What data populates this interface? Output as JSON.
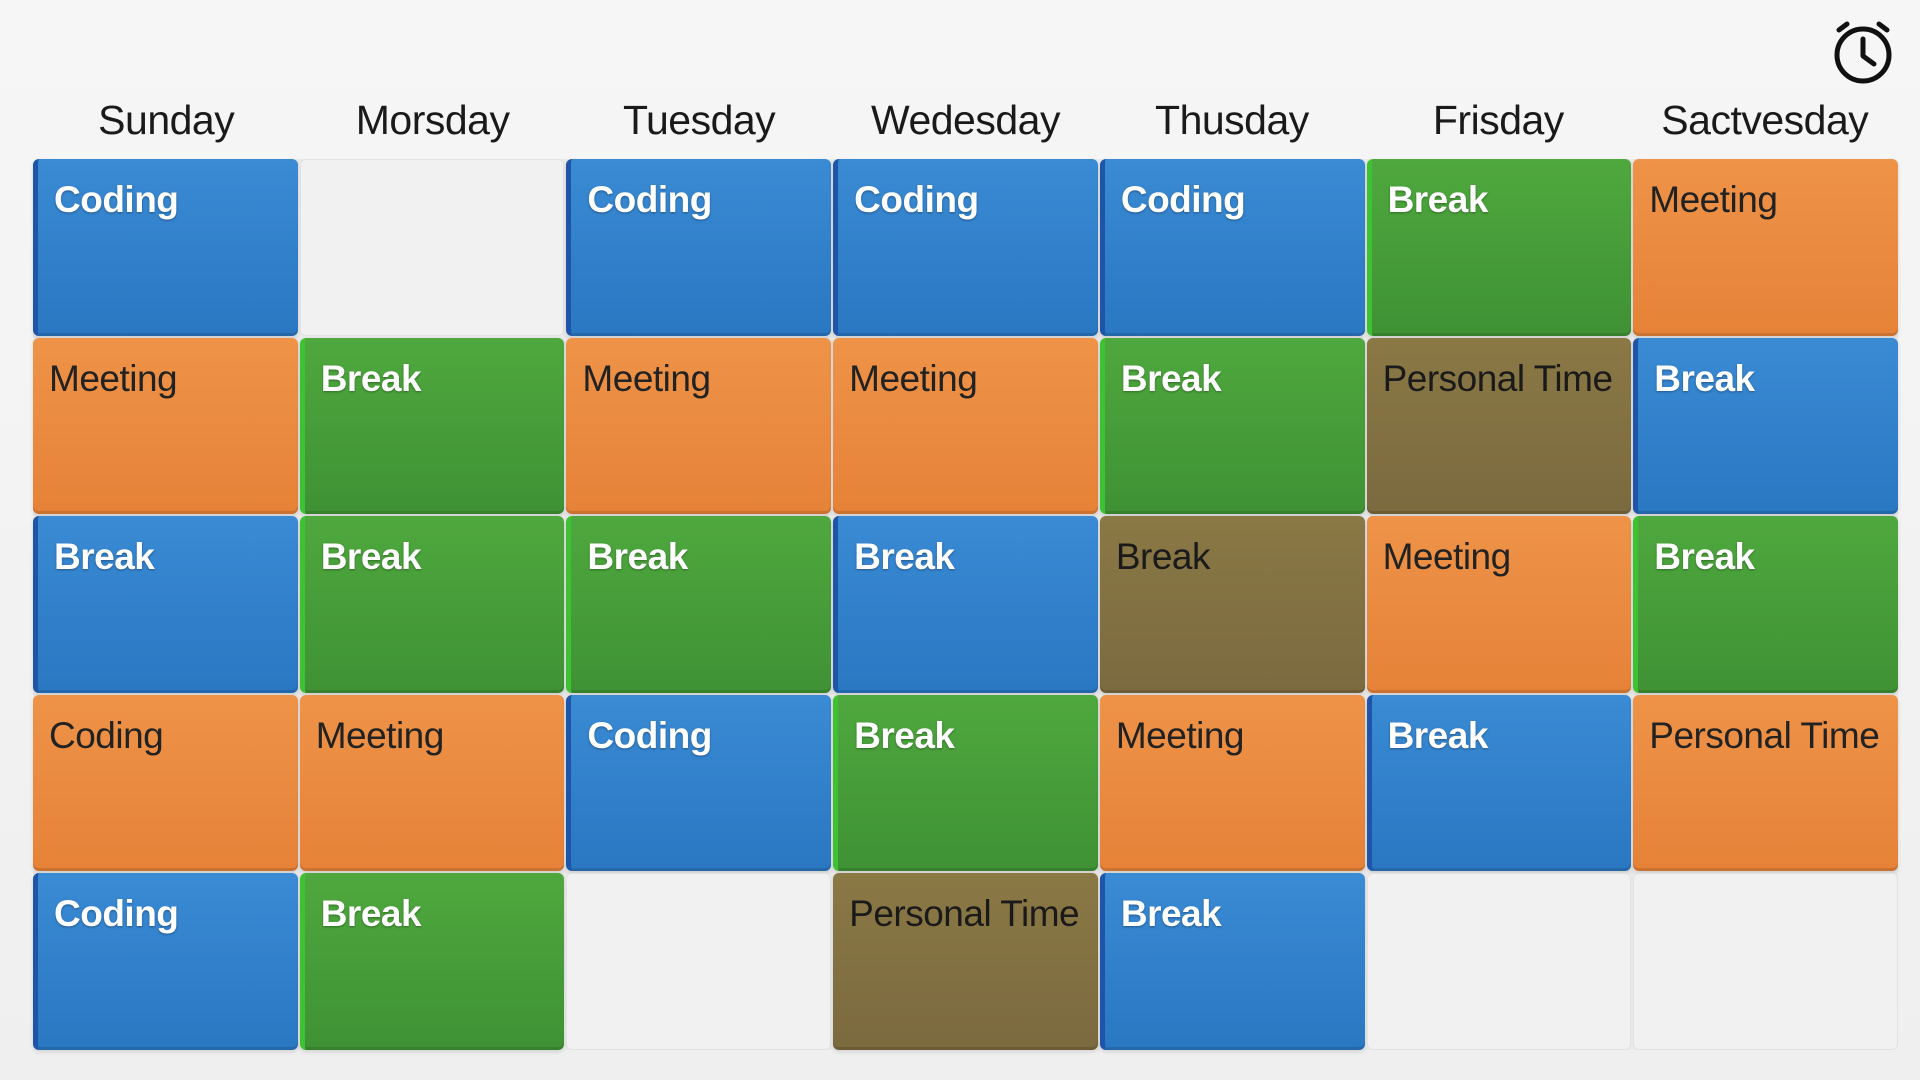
{
  "clock_icon": "alarm-clock-icon",
  "days": [
    "Sunday",
    "Morsday",
    "Tuesday",
    "Wedesday",
    "Thusday",
    "Frisday",
    "Sactvesday"
  ],
  "colors": {
    "blue": "#2a7bc6",
    "orange": "#e8873c",
    "green": "#45993a",
    "olive": "#7f6e41"
  },
  "rows": [
    [
      {
        "label": "Coding",
        "color": "blue"
      },
      {
        "label": "",
        "color": "empty"
      },
      {
        "label": "Coding",
        "color": "blue"
      },
      {
        "label": "Coding",
        "color": "blue"
      },
      {
        "label": "Coding",
        "color": "blue"
      },
      {
        "label": "Break",
        "color": "green"
      },
      {
        "label": "Meeting",
        "color": "orange"
      }
    ],
    [
      {
        "label": "Meeting",
        "color": "orange"
      },
      {
        "label": "Break",
        "color": "green"
      },
      {
        "label": "Meeting",
        "color": "orange"
      },
      {
        "label": "Meeting",
        "color": "orange"
      },
      {
        "label": "Break",
        "color": "green"
      },
      {
        "label": "Personal Time",
        "color": "olive"
      },
      {
        "label": "Break",
        "color": "blue"
      }
    ],
    [
      {
        "label": "Break",
        "color": "blue"
      },
      {
        "label": "Break",
        "color": "green"
      },
      {
        "label": "Break",
        "color": "green"
      },
      {
        "label": "Break",
        "color": "blue"
      },
      {
        "label": "Break",
        "color": "olive"
      },
      {
        "label": "Meeting",
        "color": "orange"
      },
      {
        "label": "Break",
        "color": "green"
      }
    ],
    [
      {
        "label": "Coding",
        "color": "orange"
      },
      {
        "label": "Meeting",
        "color": "orange"
      },
      {
        "label": "Coding",
        "color": "blue"
      },
      {
        "label": "Break",
        "color": "green"
      },
      {
        "label": "Meeting",
        "color": "orange"
      },
      {
        "label": "Break",
        "color": "blue"
      },
      {
        "label": "Personal Time",
        "color": "orange"
      }
    ],
    [
      {
        "label": "Coding",
        "color": "blue"
      },
      {
        "label": "Break",
        "color": "green"
      },
      {
        "label": "",
        "color": "empty"
      },
      {
        "label": "Personal Time",
        "color": "olive"
      },
      {
        "label": "Break",
        "color": "blue"
      },
      {
        "label": "",
        "color": "empty"
      },
      {
        "label": "",
        "color": "empty"
      }
    ]
  ]
}
